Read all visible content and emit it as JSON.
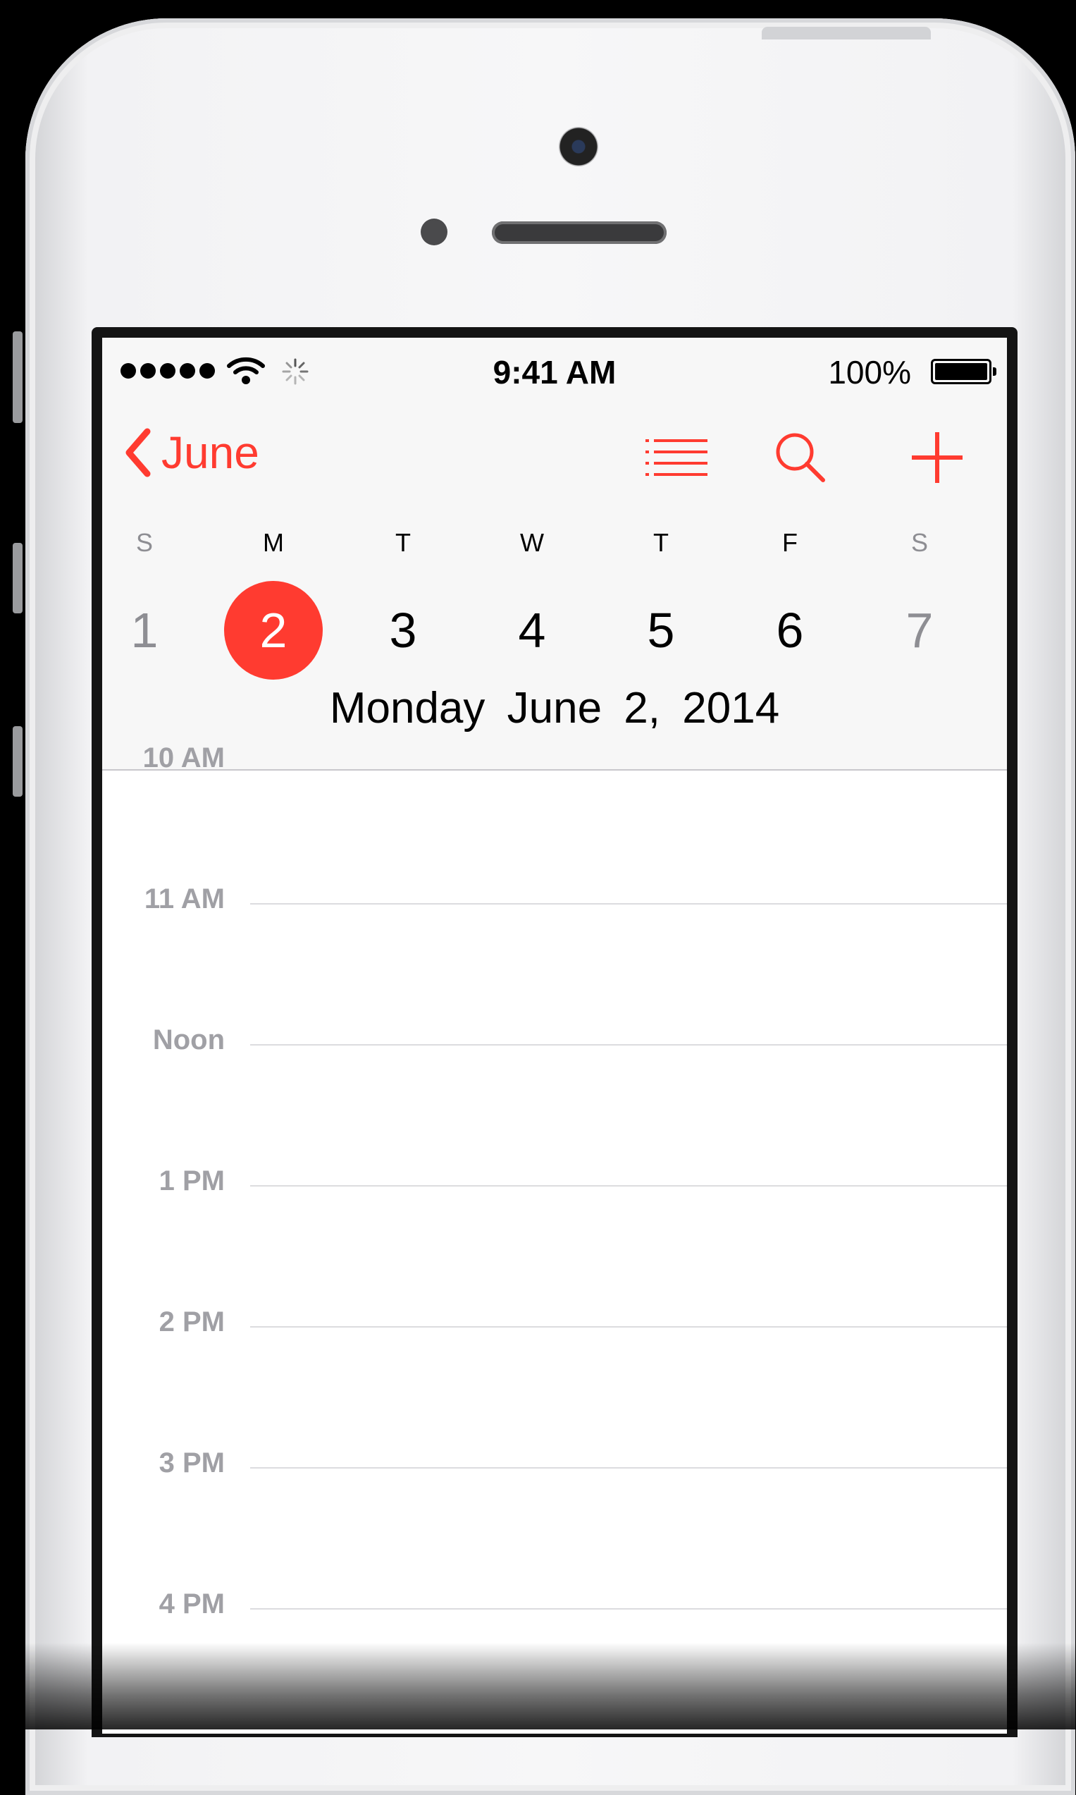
{
  "status_bar": {
    "signal_icon": "signal-dots-icon",
    "wifi_icon": "wifi-icon",
    "activity_icon": "activity-spinner-icon",
    "time": "9:41 AM",
    "battery_percent": "100%",
    "battery_level": 1.0
  },
  "nav": {
    "back_label": "June",
    "list_icon": "list-icon",
    "search_icon": "search-icon",
    "add_icon": "plus-icon"
  },
  "week": {
    "weekdays": [
      "S",
      "M",
      "T",
      "W",
      "T",
      "F",
      "S"
    ],
    "days": [
      "1",
      "2",
      "3",
      "4",
      "5",
      "6",
      "7"
    ],
    "selected_index": 1
  },
  "selected_date": {
    "weekday": "Monday",
    "date": "June 2, 2014"
  },
  "timeline": {
    "partial_hour": "10 AM",
    "hours": [
      "11 AM",
      "Noon",
      "1 PM",
      "2 PM",
      "3 PM",
      "4 PM"
    ]
  },
  "colors": {
    "accent": "#ff3b30",
    "header_bg": "#f7f7f7",
    "muted_text": "#8e8e93",
    "hour_text": "#a0a0a5"
  }
}
